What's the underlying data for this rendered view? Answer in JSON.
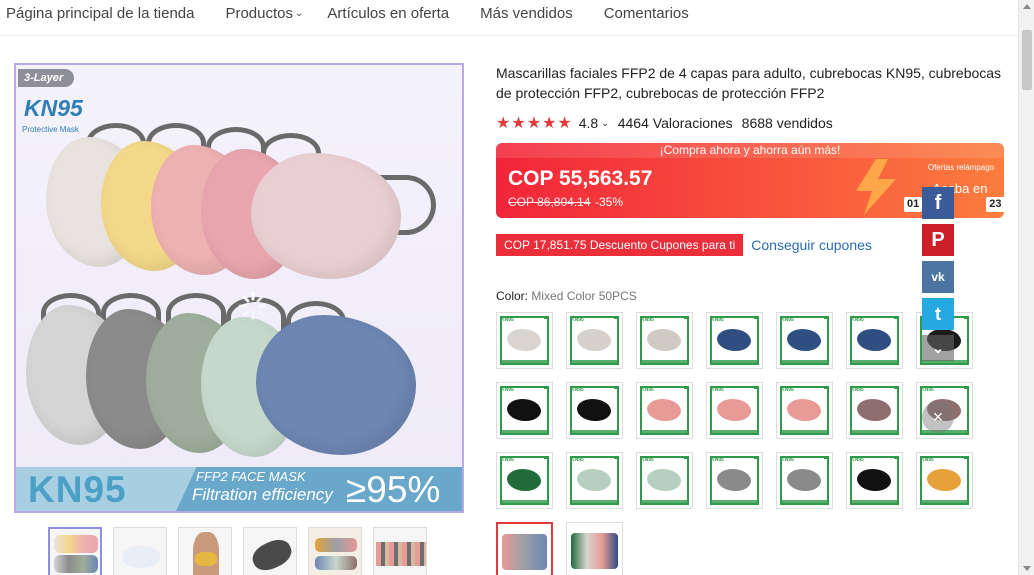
{
  "nav": {
    "items": [
      {
        "label": "Página principal de la tienda"
      },
      {
        "label": "Productos",
        "has_dropdown": true
      },
      {
        "label": "Artículos en oferta"
      },
      {
        "label": "Más vendidos"
      },
      {
        "label": "Comentarios"
      }
    ]
  },
  "image": {
    "badge": "3-Layer",
    "logo": "KN95",
    "logo_sub": "Protective Mask",
    "bottom_big": "KN95",
    "bottom_line1": "FFP2 FACE MASK",
    "bottom_line2": "Filtration efficiency",
    "bottom_pct": "≥95%"
  },
  "product": {
    "title": "Mascarillas faciales FFP2 de 4 capas para adulto, cubrebocas KN95, cubrebocas de protección FFP2, cubrebocas de protección FFP2",
    "rating": "4.8",
    "reviews": "4464 Valoraciones",
    "sold": "8688 vendidos"
  },
  "price": {
    "banner": "¡Compra ahora y ahorra aún más!",
    "current": "COP 55,563.57",
    "original": "COP 86,804.14",
    "discount": "-35%",
    "flash_label": "Ofertas relámpago",
    "flash_ends": "Acaba en",
    "timer": [
      "01",
      "",
      "23"
    ]
  },
  "coupon": {
    "tag": "COP 17,851.75 Descuento Cupones para ti",
    "link": "Conseguir cupones"
  },
  "color": {
    "label": "Color:",
    "value": "Mixed Color 50PCS",
    "swatch_head": "KN95"
  },
  "swatch_colors": [
    "#d9d4cf",
    "#d6d1cc",
    "#cfcac4",
    "#2f4f82",
    "#2f4f82",
    "#2f4f82",
    "#1a1a1a",
    "#111111",
    "#111111",
    "#e79a96",
    "#e79a96",
    "#e79a96",
    "#8e6e6e",
    "#8e6e6e",
    "#1f6b3a",
    "#b7cfc0",
    "#b7cfc0",
    "#8a8a8a",
    "#8a8a8a",
    "#111111",
    "#e6a13a"
  ],
  "social": {
    "facebook": "f",
    "pinterest": "P",
    "vk": "vk",
    "twitter": "t",
    "collapse": "⌄",
    "close": "×"
  },
  "colors": {
    "accent_red": "#e23b3b",
    "link_blue": "#2a6db5"
  }
}
